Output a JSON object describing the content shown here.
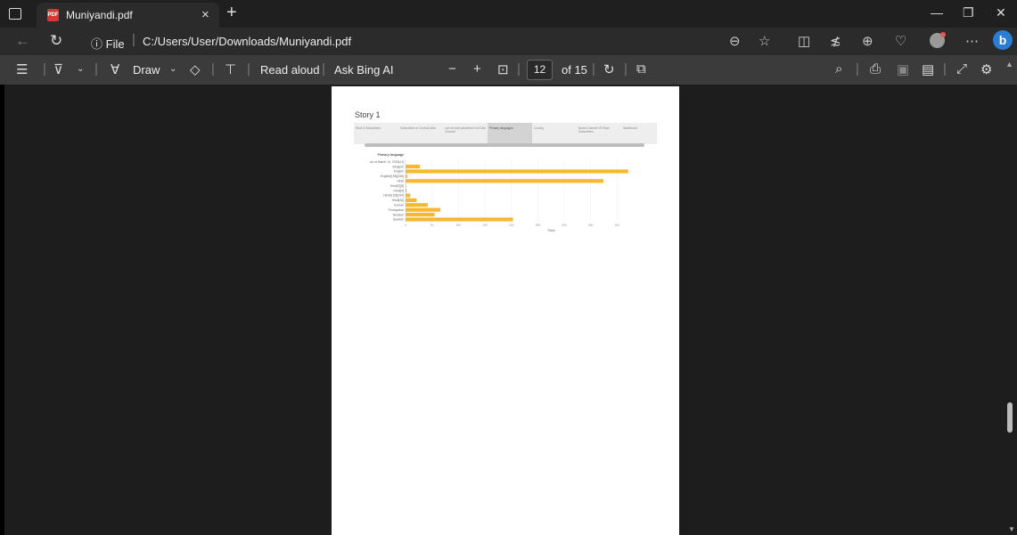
{
  "browser": {
    "tab_title": "Muniyandi.pdf",
    "favicon_text": "PDF",
    "url_info": "File",
    "url": "C:/Users/User/Downloads/Muniyandi.pdf"
  },
  "pdf_toolbar": {
    "draw_label": "Draw",
    "read_aloud_label": "Read aloud",
    "ask_bing_label": "Ask Bing AI",
    "page_current": "12",
    "page_total": "of 15"
  },
  "story": {
    "title": "Story 1",
    "tabs": [
      "Rank & Subscribers",
      "Subscribers in Crores/Lakhs",
      "List of most subscribed YouTube Channel",
      "Primary languages",
      "Country",
      "Brand Channel VS Rank Subscribers",
      "Dashboard"
    ],
    "active_tab": 3
  },
  "chart_data": {
    "type": "bar",
    "orientation": "horizontal",
    "title": "Primary language",
    "xlabel": "Rank",
    "categories": [
      "As of March 14, 2023[±1]",
      "Bhojpuri",
      "English",
      "English[155][156]",
      "Hindi",
      "Hindi[7][8]",
      "Hindi[9]",
      "Hindi[153][154]",
      "Hindi[16]",
      "Korean",
      "Portuguese",
      "Russian",
      "Spanish"
    ],
    "values": [
      0,
      27,
      421,
      3,
      374,
      1,
      2,
      9,
      21,
      42,
      66,
      55,
      203
    ],
    "xlim": [
      0,
      450
    ],
    "xticks": [
      "0",
      "50",
      "100",
      "150",
      "200",
      "250",
      "300",
      "350",
      "400"
    ],
    "bar_color": "#f7b731",
    "grid": true
  }
}
